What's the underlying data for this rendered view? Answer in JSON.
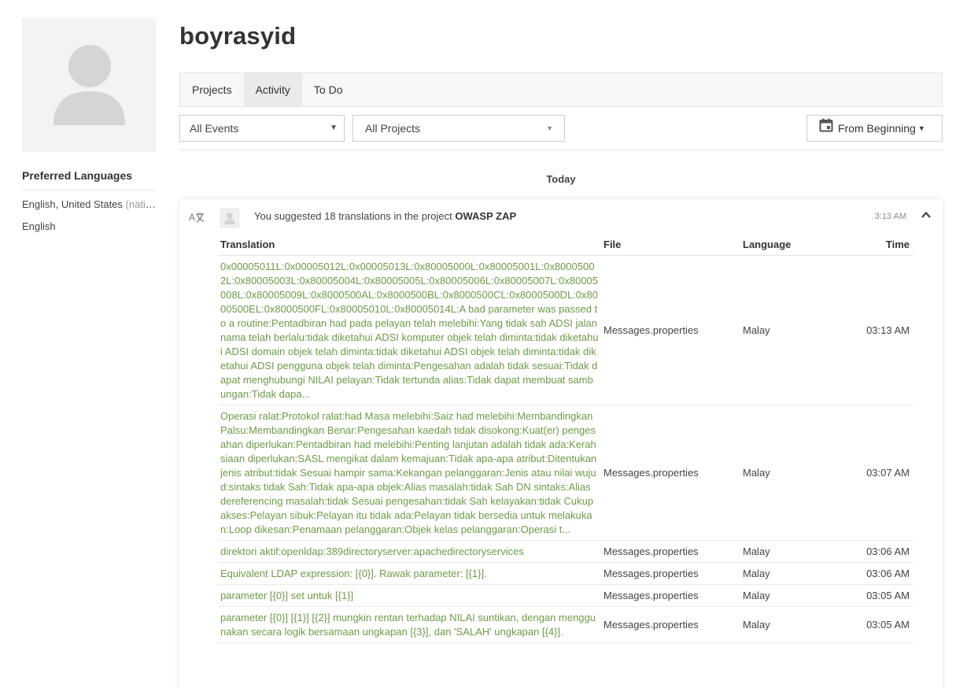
{
  "sidebar": {
    "preferred_title": "Preferred Languages",
    "languages": [
      {
        "name": "English, United States",
        "note": "(native)"
      },
      {
        "name": "English",
        "note": ""
      }
    ]
  },
  "profile": {
    "username": "boyrasyid"
  },
  "tabs": [
    {
      "label": "Projects",
      "active": false
    },
    {
      "label": "Activity",
      "active": true
    },
    {
      "label": "To Do",
      "active": false
    }
  ],
  "filters": {
    "events": "All Events",
    "projects": "All Projects",
    "date": "From Beginning"
  },
  "feed": {
    "day_label": "Today",
    "item": {
      "message_prefix": "You suggested 18 translations in the project",
      "project": "OWASP ZAP",
      "time": "3:13 AM"
    },
    "columns": {
      "translation": "Translation",
      "file": "File",
      "language": "Language",
      "time": "Time"
    },
    "rows": [
      {
        "translation": "0x00005011L:0x00005012L:0x00005013L:0x80005000L:0x80005001L:0x80005002L:0x80005003L:0x80005004L:0x80005005L:0x80005006L:0x80005007L:0x80005008L:0x80005009L:0x8000500AL:0x8000500BL:0x8000500CL:0x8000500DL:0x8000500EL:0x8000500FL:0x80005010L:0x80005014L:A bad parameter was passed to a routine:Pentadbiran had pada pelayan telah melebihi:Yang tidak sah ADSI jalan nama telah berlalu:tidak diketahui ADSI komputer objek telah diminta:tidak diketahui ADSI domain objek telah diminta:tidak diketahui ADSI objek telah diminta:tidak diketahui ADSI pengguna objek telah diminta:Pengesahan adalah tidak sesuai:Tidak dapat menghubungi NILAI pelayan:Tidak tertunda alias:Tidak dapat membuat sambungan:Tidak dapa...",
        "file": "Messages.properties",
        "language": "Malay",
        "time": "03:13 AM",
        "lines": 10
      },
      {
        "translation": "Operasi ralat:Protokol ralat:had Masa melebihi:Saiz had melebihi:Membandingkan Palsu:Membandingkan Benar:Pengesahan kaedah tidak disokong:Kuat(er) pengesahan diperlukan:Pentadbiran had melebihi:Penting lanjutan adalah tidak ada:Kerahsiaan diperlukan:SASL mengikat dalam kemajuan:Tidak apa-apa atribut:Ditentukan jenis atribut:tidak Sesuai hampir sama:Kekangan pelanggaran:Jenis atau nilai wujud:sintaks tidak Sah:Tidak apa-apa objek:Alias masalah:tidak Sah DN sintaks:Alias dereferencing masalah:tidak Sesuai pengesahan:tidak Sah kelayakan:tidak Cukup akses:Pelayan sibuk:Pelayan itu tidak ada:Pelayan tidak bersedia untuk melakukan:Loop dikesan:Penamaan pelanggaran:Objek kelas pelanggaran:Operasi t...",
        "file": "Messages.properties",
        "language": "Malay",
        "time": "03:07 AM",
        "lines": 11
      },
      {
        "translation": "direktori aktif:openldap:389directoryserver:apachedirectoryservices",
        "file": "Messages.properties",
        "language": "Malay",
        "time": "03:06 AM",
        "lines": 1
      },
      {
        "translation": "Equivalent LDAP expression: [{0}]. Rawak parameter: [{1}].",
        "file": "Messages.properties",
        "language": "Malay",
        "time": "03:06 AM",
        "lines": 1
      },
      {
        "translation": "parameter [{0}] set untuk [{1}]",
        "file": "Messages.properties",
        "language": "Malay",
        "time": "03:05 AM",
        "lines": 1
      },
      {
        "translation": "parameter [{0}] [{1}] [{2}] mungkin rentan terhadap NILAI suntikan, dengan menggunakan secara logik bersamaan ungkapan [{3}], dan 'SALAH' ungkapan [{4}].",
        "file": "Messages.properties",
        "language": "Malay",
        "time": "03:05 AM",
        "lines": 3
      }
    ]
  }
}
